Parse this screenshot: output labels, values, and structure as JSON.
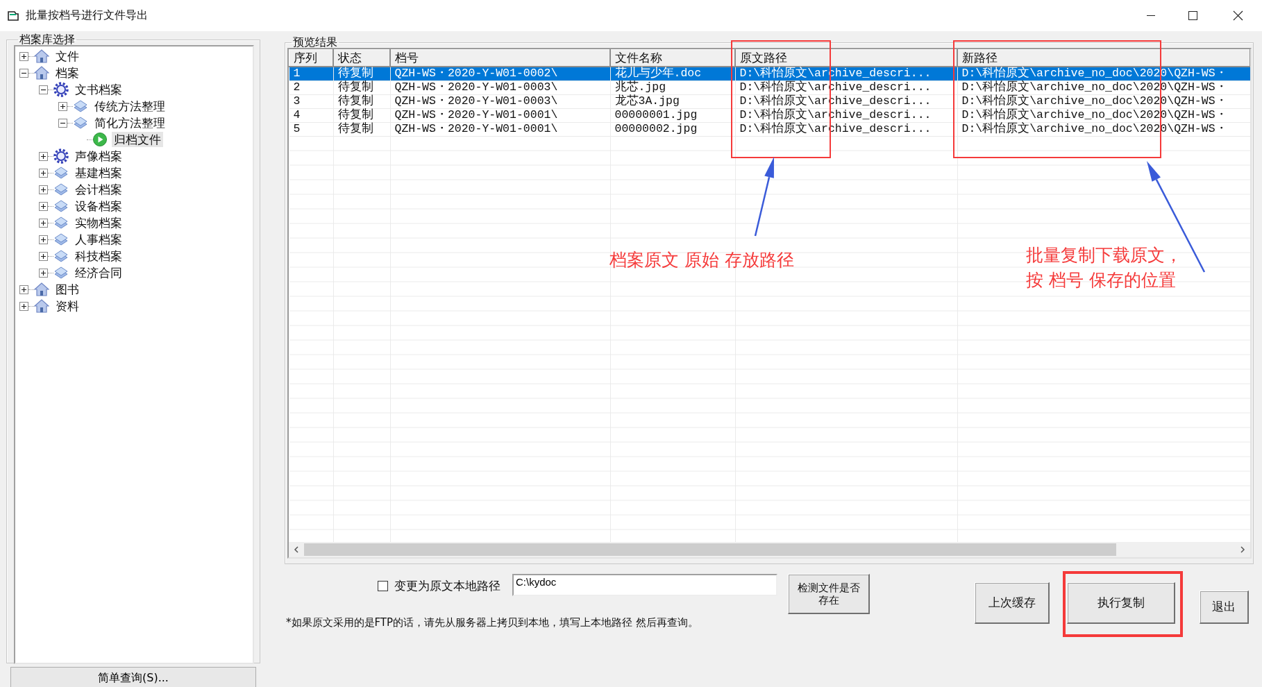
{
  "window": {
    "title": "批量按档号进行文件导出"
  },
  "archive_tree": {
    "title": "档案库选择",
    "items": [
      {
        "label": "文件",
        "kind": "house",
        "expanded": false,
        "selected": false
      },
      {
        "label": "档案",
        "kind": "house",
        "expanded": true,
        "selected": false,
        "children": [
          {
            "label": "文书档案",
            "kind": "gear",
            "expanded": true,
            "selected": false,
            "children": [
              {
                "label": "传统方法整理",
                "kind": "layer",
                "expanded": false,
                "selected": false
              },
              {
                "label": "简化方法整理",
                "kind": "layer",
                "expanded": true,
                "selected": false,
                "children": [
                  {
                    "label": "归档文件",
                    "kind": "play",
                    "selected": true
                  }
                ]
              }
            ]
          },
          {
            "label": "声像档案",
            "kind": "gear",
            "expanded": false,
            "selected": false
          },
          {
            "label": "基建档案",
            "kind": "layer",
            "expanded": false,
            "selected": false
          },
          {
            "label": "会计档案",
            "kind": "layer",
            "expanded": false,
            "selected": false
          },
          {
            "label": "设备档案",
            "kind": "layer",
            "expanded": false,
            "selected": false
          },
          {
            "label": "实物档案",
            "kind": "layer",
            "expanded": false,
            "selected": false
          },
          {
            "label": "人事档案",
            "kind": "layer",
            "expanded": false,
            "selected": false
          },
          {
            "label": "科技档案",
            "kind": "layer",
            "expanded": false,
            "selected": false
          },
          {
            "label": "经济合同",
            "kind": "layer",
            "expanded": false,
            "selected": false
          }
        ]
      },
      {
        "label": "图书",
        "kind": "house",
        "expanded": false,
        "selected": false
      },
      {
        "label": "资料",
        "kind": "house",
        "expanded": false,
        "selected": false
      }
    ]
  },
  "simple_query_button": "简单查询(S)...",
  "preview": {
    "title": "预览结果",
    "columns": [
      {
        "label": "序列",
        "highlighted": false
      },
      {
        "label": "状态",
        "highlighted": false
      },
      {
        "label": "档号",
        "highlighted": false
      },
      {
        "label": "文件名称",
        "highlighted": false
      },
      {
        "label": "原文路径",
        "highlighted": true
      },
      {
        "label": "新路径",
        "highlighted": true
      }
    ],
    "rows": [
      {
        "selected": true,
        "cells": [
          "1",
          "待复制",
          "QZH-WS・2020-Y-W01-0002\\",
          "花儿与少年.doc",
          "D:\\科怡原文\\archive_descri...",
          "D:\\科怡原文\\archive_no_doc\\2020\\QZH-WS・"
        ]
      },
      {
        "selected": false,
        "cells": [
          "2",
          "待复制",
          "QZH-WS・2020-Y-W01-0003\\",
          "兆芯.jpg",
          "D:\\科怡原文\\archive_descri...",
          "D:\\科怡原文\\archive_no_doc\\2020\\QZH-WS・"
        ]
      },
      {
        "selected": false,
        "cells": [
          "3",
          "待复制",
          "QZH-WS・2020-Y-W01-0003\\",
          "龙芯3A.jpg",
          "D:\\科怡原文\\archive_descri...",
          "D:\\科怡原文\\archive_no_doc\\2020\\QZH-WS・"
        ]
      },
      {
        "selected": false,
        "cells": [
          "4",
          "待复制",
          "QZH-WS・2020-Y-W01-0001\\",
          "00000001.jpg",
          "D:\\科怡原文\\archive_descri...",
          "D:\\科怡原文\\archive_no_doc\\2020\\QZH-WS・"
        ]
      },
      {
        "selected": false,
        "cells": [
          "5",
          "待复制",
          "QZH-WS・2020-Y-W01-0001\\",
          "00000002.jpg",
          "D:\\科怡原文\\archive_descri...",
          "D:\\科怡原文\\archive_no_doc\\2020\\QZH-WS・"
        ]
      }
    ]
  },
  "local_path": {
    "label": "变更为原文本地路径",
    "checked": false,
    "value": "C:\\kydoc"
  },
  "check_button": "检测文件是否存在",
  "note": "*如果原文采用的是FTP的话，请先从服务器上拷贝到本地，填写上本地路径 然后再查询。",
  "buttons": [
    {
      "label": "上次缓存",
      "highlighted": false
    },
    {
      "label": "执行复制",
      "highlighted": true
    },
    {
      "label": "退出",
      "highlighted": false
    }
  ],
  "annotations": [
    {
      "lines": [
        "档案原文 原始 存放路径"
      ]
    },
    {
      "lines": [
        "批量复制下载原文，",
        "按 档号 保存的位置"
      ]
    }
  ]
}
